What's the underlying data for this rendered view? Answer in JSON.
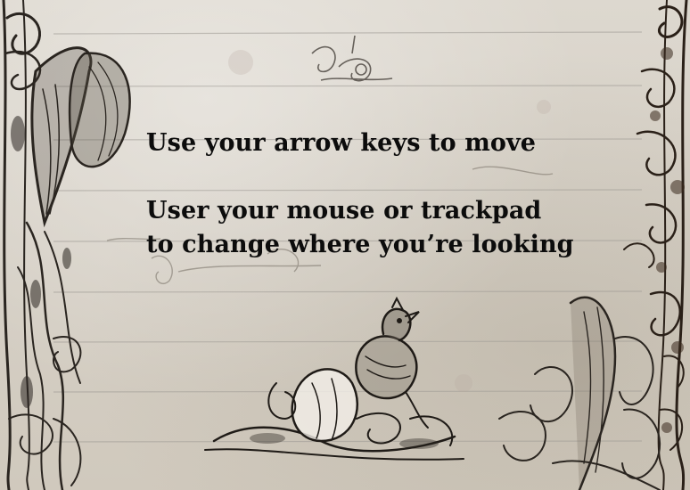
{
  "screen": {
    "type": "game-instructions",
    "instructions": {
      "move": "Use your arrow keys to move",
      "look_line_1": "User your mouse or trackpad",
      "look_line_2": "to change where you’re looking"
    }
  },
  "decorations": {
    "left_border": "engraved-foliage-illustration",
    "right_border": "engraved-floral-border",
    "bottom_center": "engraved-bird-on-flower-illustration",
    "bottom_right": "engraved-leaf-cluster-illustration",
    "top_center": "small-floral-sprig-ornament",
    "middle_left": "faded-scroll-ornament",
    "paper_color": "#d9d4cb",
    "ink_color": "#0c0c0c"
  }
}
